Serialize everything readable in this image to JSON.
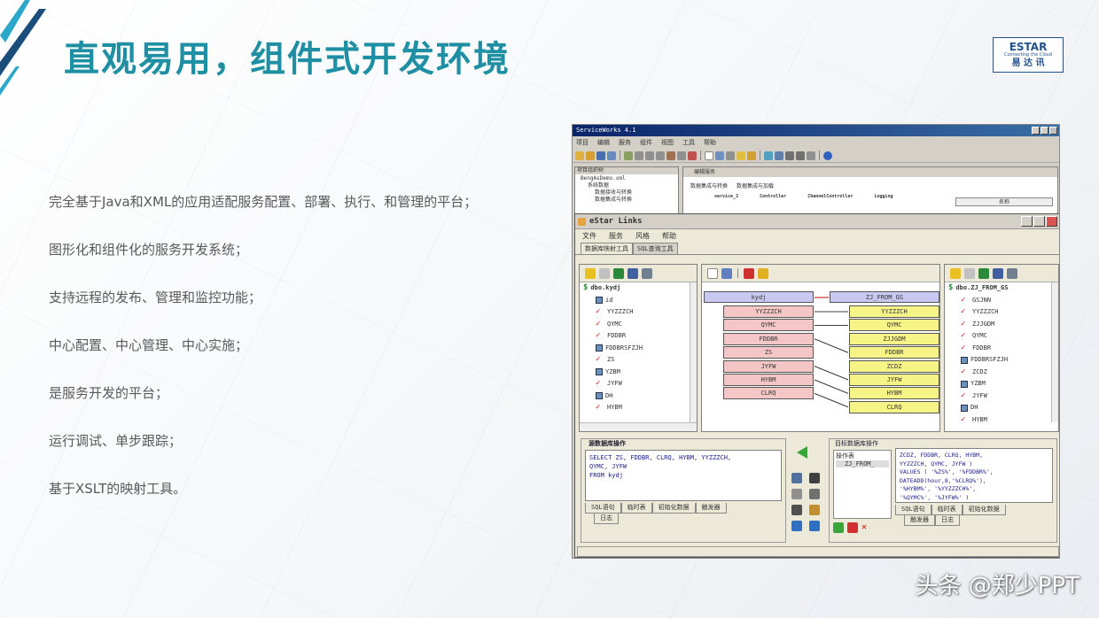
{
  "slide": {
    "title": "直观易用，组件式开发环境",
    "logo": {
      "main": "ESTAR",
      "tagline": "Connecting the Cloud",
      "cn": "易 达 讯"
    },
    "bullets": [
      "完全基于Java和XML的应用适配服务配置、部署、执行、和管理的平台；",
      "图形化和组件化的服务开发系统；",
      "支持远程的发布、管理和监控功能；",
      "中心配置、中心管理、中心实施；",
      "是服务开发的平台；",
      "运行调试、单步跟踪；",
      "基于XSLT的映射工具。"
    ],
    "watermark": "头条 @郑少PPT",
    "colors": {
      "title": "#1f8fa3",
      "accent_dark": "#1b4d7a",
      "accent_light": "#2aa7c9"
    }
  },
  "screenshot": {
    "sw_title": "ServiceWorks 4.1",
    "sw_menu": [
      "项目",
      "编辑",
      "服务",
      "组件",
      "视图",
      "工具",
      "帮助"
    ],
    "sw_tree": {
      "header": "项目组织树",
      "items": [
        "BengAsDemo.xml",
        "系统数据",
        "数据接收与转换",
        "数据集成与转换"
      ]
    },
    "sw_panel": {
      "header": "编辑服务",
      "tabs": [
        "数据集成与转换",
        "数据集成与加载"
      ],
      "columns": [
        "service_2",
        "Controller",
        "ChannelController",
        "Logging"
      ],
      "name_label": "名称"
    },
    "el_title": "eStar Links",
    "el_menu": [
      "文件",
      "服务",
      "风格",
      "帮助"
    ],
    "el_tabs": [
      "数据库映射工具",
      "SQL查询工具"
    ],
    "left_tree": {
      "root": "dbo.kydj",
      "fields": [
        {
          "name": "id",
          "type": "key"
        },
        {
          "name": "YYZZZCH",
          "type": "check"
        },
        {
          "name": "QYMC",
          "type": "check"
        },
        {
          "name": "FDDBR",
          "type": "check"
        },
        {
          "name": "FDDBRSFZJH",
          "type": "key"
        },
        {
          "name": "ZS",
          "type": "check"
        },
        {
          "name": "YZBM",
          "type": "key"
        },
        {
          "name": "JYFW",
          "type": "check"
        },
        {
          "name": "DH",
          "type": "key"
        },
        {
          "name": "HYBM",
          "type": "check"
        }
      ]
    },
    "mapping": {
      "source_table": "kydj",
      "target_table": "ZJ_FROM_GS",
      "source_fields": [
        "YYZZZCH",
        "QYMC",
        "FDDBR",
        "ZS",
        "JYFW",
        "HYBM",
        "CLRQ"
      ],
      "target_fields": [
        "YYZZZCH",
        "QYMC",
        "ZJJGDM",
        "FDDBR",
        "ZCDZ",
        "JYFW",
        "HYBM",
        "CLRQ"
      ]
    },
    "right_tree": {
      "root": "dbo.ZJ_FROM_GS",
      "fields": [
        {
          "name": "GSJNN",
          "type": "check"
        },
        {
          "name": "YYZZZCH",
          "type": "check"
        },
        {
          "name": "ZJJGDM",
          "type": "check"
        },
        {
          "name": "QYMC",
          "type": "check"
        },
        {
          "name": "FDDBR",
          "type": "check"
        },
        {
          "name": "FDDBRSFZJH",
          "type": "key"
        },
        {
          "name": "ZCDZ",
          "type": "check"
        },
        {
          "name": "YZBM",
          "type": "key"
        },
        {
          "name": "JYFW",
          "type": "check"
        },
        {
          "name": "DH",
          "type": "key"
        },
        {
          "name": "HYBM",
          "type": "check"
        }
      ]
    },
    "src_ops": {
      "legend": "源数据库操作",
      "sql": [
        "SELECT ZS, FDDBR, CLRQ, HYBM, YYZZZCH,",
        "QYMC, JYFW",
        "FROM kydj"
      ],
      "tabs": [
        "SQL语句",
        "临时表",
        "初始化数据",
        "触发器"
      ],
      "tab2": "日志"
    },
    "dst_ops": {
      "legend": "目标数据库操作",
      "tree_root": "操作表",
      "tree_child": "ZJ_FROM_",
      "sql": [
        "ZCDZ, FDDBR, CLRQ, HYBM,",
        "YYZZZCH, QYMC, JYFW )",
        "VALUES ( '%ZS%', '%FDDBR%',",
        "DATEADD(hour,8,'%CLRQ%'),",
        "'%HYBM%', '%YYZZZCH%',",
        "'%QYMC%', '%JYFW%' )"
      ],
      "tabs": [
        "SQL语句",
        "临时表",
        "初始化数据"
      ],
      "tabs2": [
        "触发器",
        "日志"
      ]
    }
  }
}
